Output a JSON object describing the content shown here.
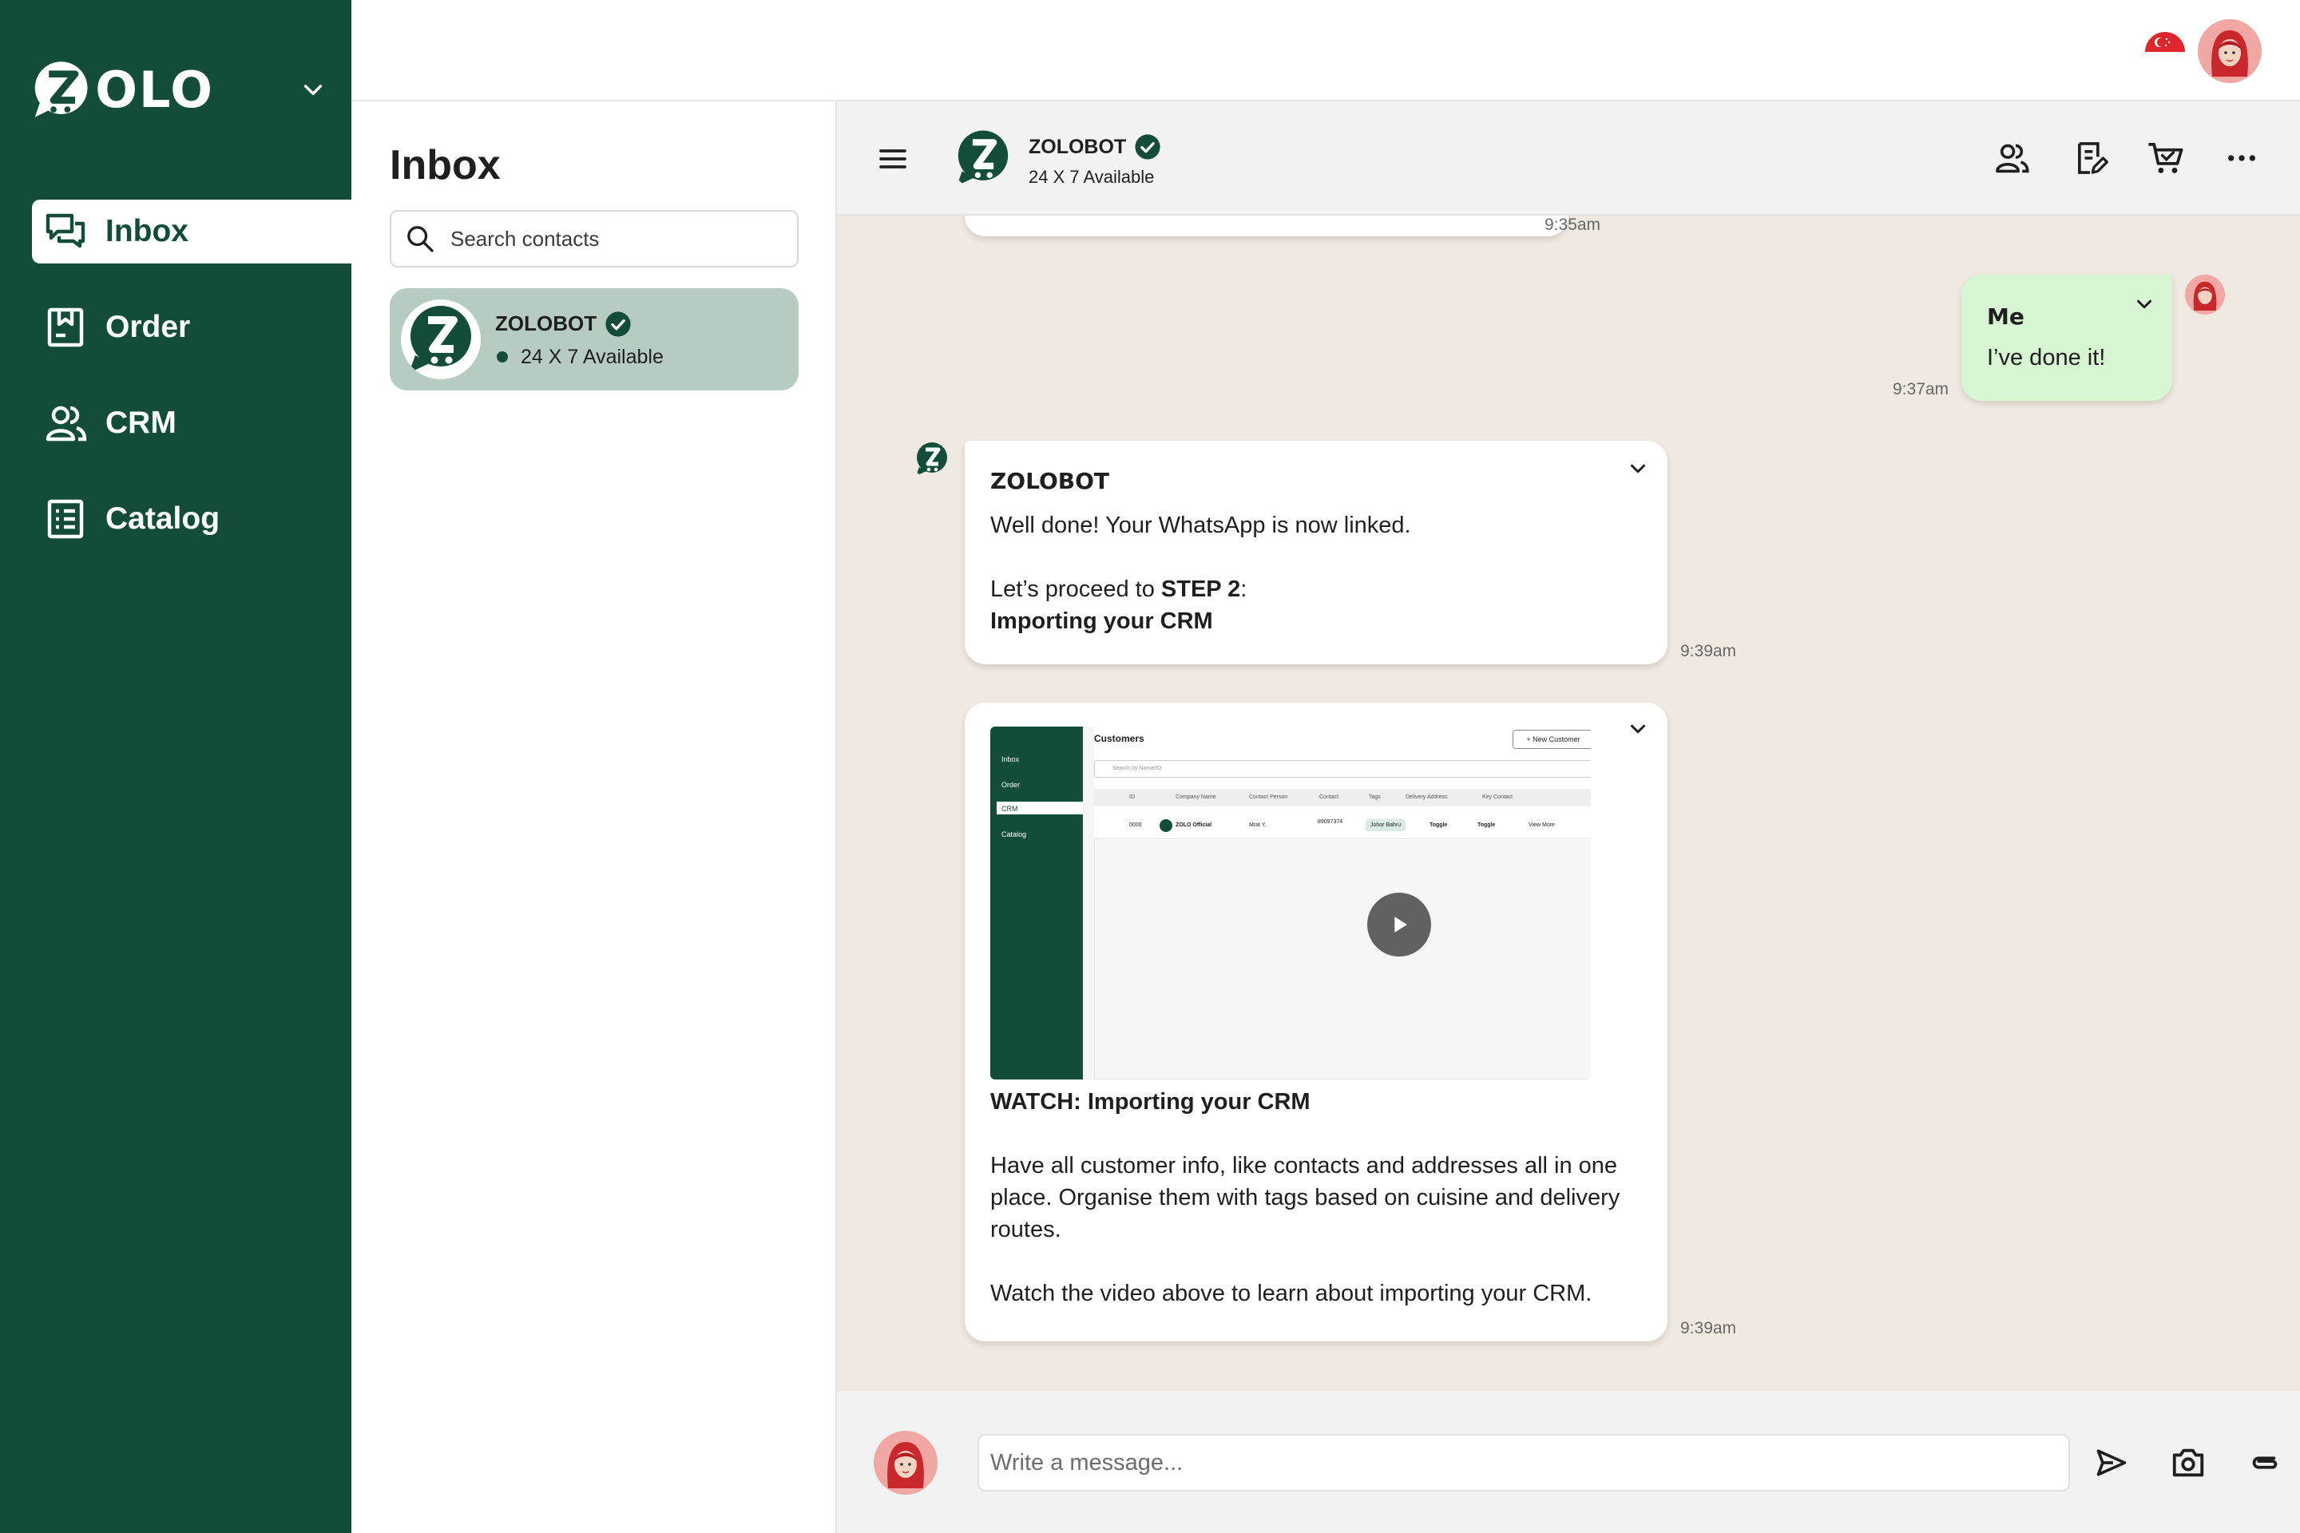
{
  "brand": {
    "logo_text": "OLO",
    "accent": "#134d3a"
  },
  "sidebar": {
    "items": [
      {
        "label": "Inbox",
        "icon": "chat-icon",
        "active": true
      },
      {
        "label": "Order",
        "icon": "order-icon",
        "active": false
      },
      {
        "label": "CRM",
        "icon": "people-icon",
        "active": false
      },
      {
        "label": "Catalog",
        "icon": "catalog-icon",
        "active": false
      }
    ]
  },
  "inbox": {
    "title": "Inbox",
    "search_placeholder": "Search contacts",
    "contacts": [
      {
        "name": "ZOLOBOT",
        "status": "24 X 7 Available"
      }
    ]
  },
  "chat": {
    "header": {
      "name": "ZOLOBOT",
      "status": "24 X 7 Available"
    },
    "messages": {
      "m0": {
        "time": "9:35am"
      },
      "m1": {
        "sender": "Me",
        "text": "I’ve done it!",
        "time": "9:37am"
      },
      "m2": {
        "sender": "ZOLOBOT",
        "line1": "Well done! Your WhatsApp is now linked.",
        "line2_prefix": "Let’s proceed to ",
        "line2_bold": "STEP 2",
        "line2_suffix": ":",
        "line3_bold": "Importing your CRM",
        "time": "9:39am"
      },
      "m3": {
        "video_title": "WATCH: Importing your CRM",
        "para1": "Have all customer info, like contacts and addresses all in one place. Organise them with tags based on cuisine and delivery routes.",
        "para2": "Watch the video above to learn about importing your CRM.",
        "time": "9:39am",
        "thumb": {
          "heading": "Customers",
          "new_button": "+ New Customer",
          "search": "Search by Name/ID",
          "nav": [
            "Inbox",
            "Order",
            "CRM",
            "Catalog"
          ],
          "columns": [
            "ID",
            "Company Name",
            "Contact Person",
            "Contact",
            "Tags",
            "Delivery Address",
            "Key Contact"
          ],
          "row": [
            "0000",
            "ZOLO Official",
            "Mrat Y.",
            "89097374",
            "Johor Bahru",
            "Toggle",
            "Toggle",
            "View More"
          ]
        }
      }
    },
    "input_placeholder": "Write a message..."
  }
}
